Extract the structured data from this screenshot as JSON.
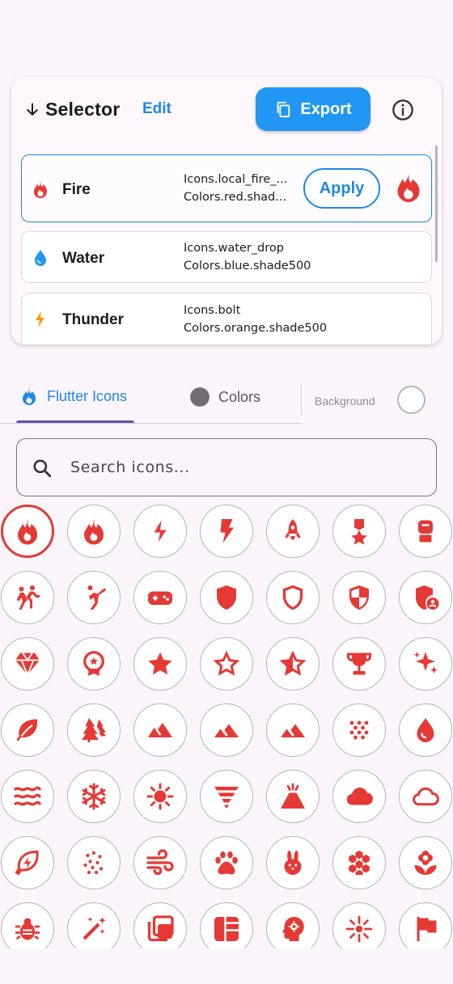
{
  "selector": {
    "title": "Selector",
    "edit_label": "Edit",
    "export_label": "Export",
    "rows": [
      {
        "name": "Fire",
        "icon": "fire-icon",
        "line1": "Icons.local_fire_...",
        "line2": "Colors.red.shad...",
        "color": "#e53935",
        "apply_label": "Apply"
      },
      {
        "name": "Water",
        "icon": "water-drop-icon",
        "line1": "Icons.water_drop",
        "line2": "Colors.blue.shade500",
        "color": "#2196f3"
      },
      {
        "name": "Thunder",
        "icon": "bolt-icon",
        "line1": "Icons.bolt",
        "line2": "Colors.orange.shade500",
        "color": "#ff9800"
      }
    ]
  },
  "tabs": {
    "flutter_icons": "Flutter Icons",
    "colors": "Colors",
    "background": "Background"
  },
  "search": {
    "placeholder": "Search icons..."
  },
  "icon_color": "#e53935",
  "icons": [
    "whatshot-icon",
    "fire-icon",
    "bolt-outline-icon",
    "flash-icon",
    "rocket-icon",
    "military-medal-icon",
    "sports-mma-icon",
    "sports-kabaddi-icon",
    "sports-martial-arts-icon",
    "gamepad-icon",
    "shield-icon",
    "shield-outline-icon",
    "security-icon",
    "admin-panel-icon",
    "diamond-icon",
    "workspace-premium-icon",
    "star-icon",
    "star-outline-icon",
    "star-half-icon",
    "trophy-icon",
    "sparkle-icon",
    "eco-leaf-icon",
    "forest-icon",
    "landscape-icon",
    "terrain-icon",
    "filter-hdr-icon",
    "blur-dots-icon",
    "water-drop-icon",
    "waves-icon",
    "ac-unit-icon",
    "sunny-icon",
    "tornado-icon",
    "volcano-icon",
    "cloud-icon",
    "cloud-outline-icon",
    "energy-savings-leaf-icon",
    "grain-icon",
    "air-icon",
    "pets-icon",
    "cruelty-free-icon",
    "hive-icon",
    "local-florist-icon",
    "pest-control-icon",
    "auto-fix-icon",
    "filter-none-icon",
    "dashboard-icon",
    "psychology-icon",
    "flare-icon",
    "flag-icon"
  ]
}
